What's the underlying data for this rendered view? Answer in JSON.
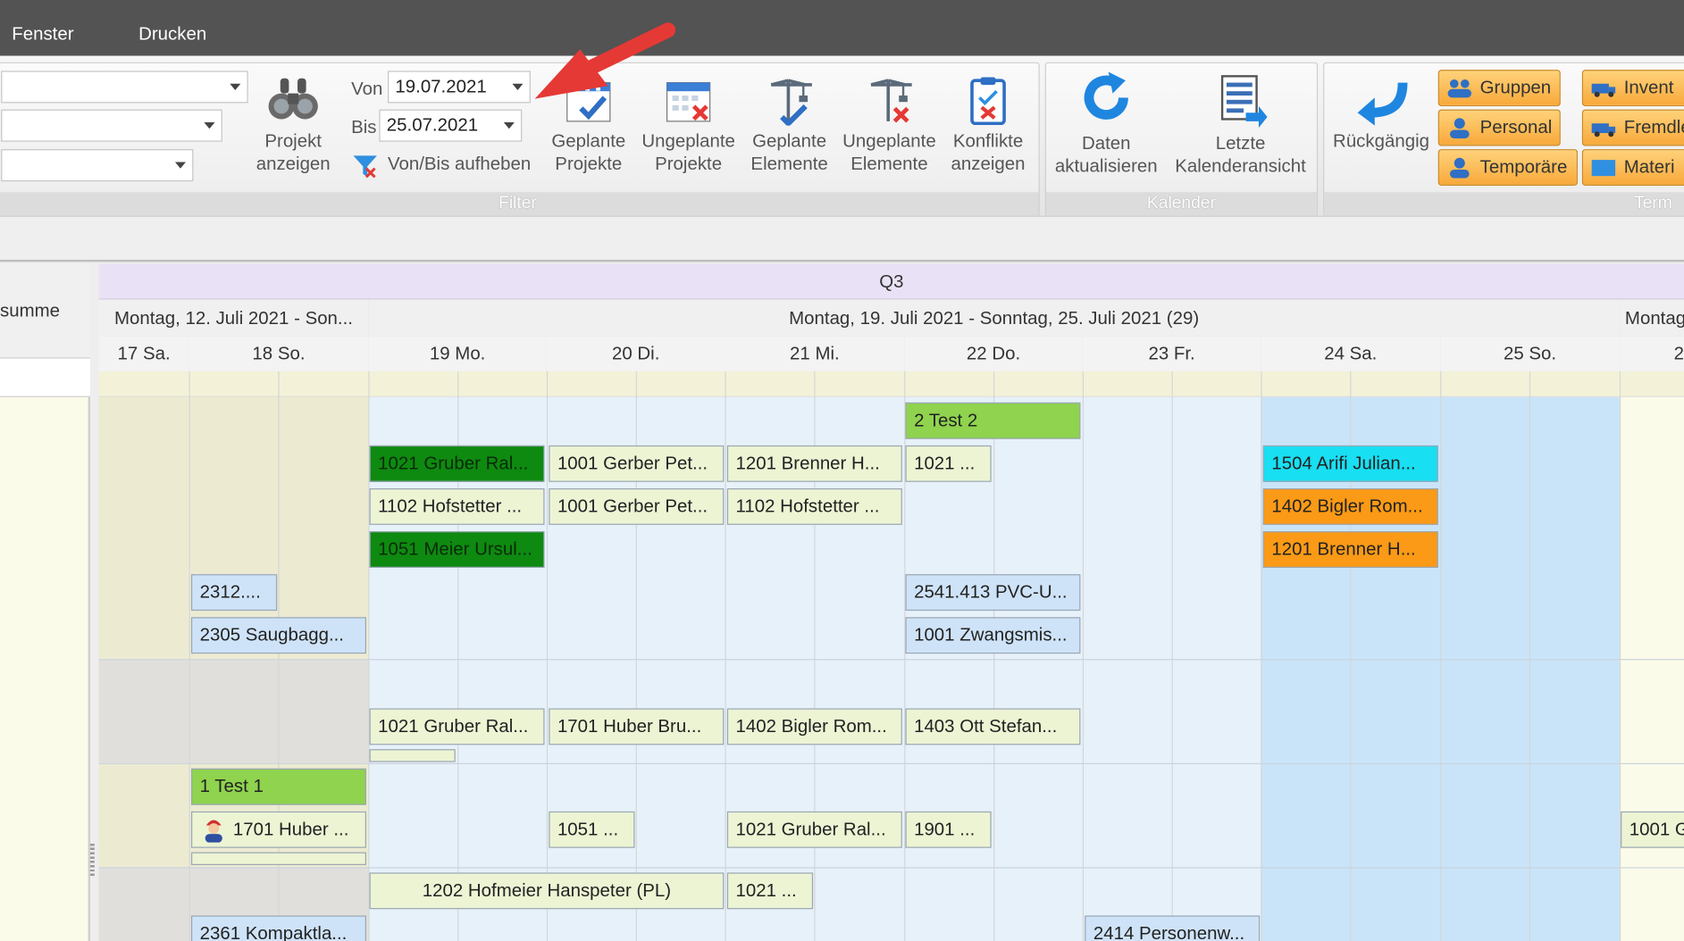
{
  "menu": [
    "Fenster",
    "Drucken"
  ],
  "filter": {
    "von_label": "Von",
    "von_value": "19.07.2021",
    "bis_label": "Bis",
    "bis_value": "25.07.2021",
    "clear_label": "Von/Bis aufheben",
    "group_label": "Filter",
    "buttons": [
      {
        "line1": "Projekt",
        "line2": "anzeigen",
        "icon": "binoculars-icon"
      },
      {
        "line1": "Geplante",
        "line2": "Projekte",
        "icon": "calendar-check-icon"
      },
      {
        "line1": "Ungeplante",
        "line2": "Projekte",
        "icon": "calendar-x-icon"
      },
      {
        "line1": "Geplante",
        "line2": "Elemente",
        "icon": "crane-check-icon"
      },
      {
        "line1": "Ungeplante",
        "line2": "Elemente",
        "icon": "crane-x-icon"
      },
      {
        "line1": "Konflikte",
        "line2": "anzeigen",
        "icon": "clipboard-conflict-icon"
      }
    ]
  },
  "kalender": {
    "group_label": "Kalender",
    "buttons": [
      {
        "line1": "Daten",
        "line2": "aktualisieren",
        "icon": "refresh-icon"
      },
      {
        "line1": "Letzte",
        "line2": "Kalenderansicht",
        "icon": "calendar-view-icon"
      }
    ]
  },
  "termin": {
    "group_label": "Term",
    "undo_label": "Rückgängig",
    "buttons": [
      "Gruppen",
      "Personal",
      "Temporäre"
    ],
    "buttons2": [
      "Invent",
      "Fremdle",
      "Materi"
    ]
  },
  "gantt": {
    "left_header": "summe",
    "quarter": "Q3",
    "weeks": [
      "Montag, 12. Juli 2021 - Son...",
      "Montag, 19. Juli 2021 - Sonntag, 25. Juli 2021 (29)",
      "Montag"
    ],
    "days": [
      "17 Sa.",
      "18 So.",
      "19 Mo.",
      "20 Di.",
      "21 Mi.",
      "22 Do.",
      "23 Fr.",
      "24 Sa.",
      "25 So.",
      "2"
    ],
    "bars": [
      "2 Test 2",
      "1021 Gruber Ral...",
      "1001 Gerber Pet...",
      "1201 Brenner H...",
      "1021 ...",
      "1504 Arifi Julian...",
      "1102 Hofstetter ...",
      "1001 Gerber Pet...",
      "1102 Hofstetter ...",
      "1402 Bigler Rom...",
      "1051 Meier Ursul...",
      "1201 Brenner H...",
      "2312....",
      "2541.413 PVC-U...",
      "2305 Saugbagg...",
      "1001 Zwangsmis...",
      "1021 Gruber Ral...",
      "1701 Huber Bru...",
      "1402 Bigler Rom...",
      "1403 Ott Stefan...",
      "1 Test 1",
      "1701 Huber ...",
      "1051 ...",
      "1021 Gruber Ral...",
      "1901 ...",
      "1001 G",
      "1202 Hofmeier Hanspeter (PL)",
      "1021 ...",
      "2361 Kompaktla...",
      "2414 Personenw..."
    ]
  },
  "colors": {
    "menubar": "#535353",
    "bar_green": "#ecf4d4",
    "bar_darkgreen": "#0e8a10",
    "bar_lime": "#8fd34e",
    "bar_blue": "#cfe3f8",
    "bar_cyan": "#18dff2",
    "bar_orange": "#fb9a16",
    "arrow": "#e53935"
  }
}
